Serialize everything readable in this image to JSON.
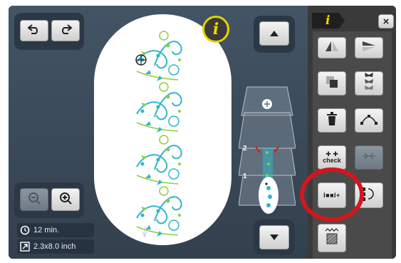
{
  "status": {
    "time": "12 min.",
    "size": "2.3x8.0 inch"
  },
  "info_label": "i",
  "right_panel": {
    "header_label": "i",
    "close_label": "×",
    "check_line1": "check",
    "join_label": "I■■I+"
  },
  "layers": {
    "layer2": "2",
    "layer1": "1"
  },
  "colors": {
    "screen": "#3d4c5c",
    "accent_yellow": "#e8d200",
    "highlight_red": "#d4161c",
    "embroidery_teal": "#2fb7c9",
    "embroidery_green": "#8dcf3f"
  }
}
